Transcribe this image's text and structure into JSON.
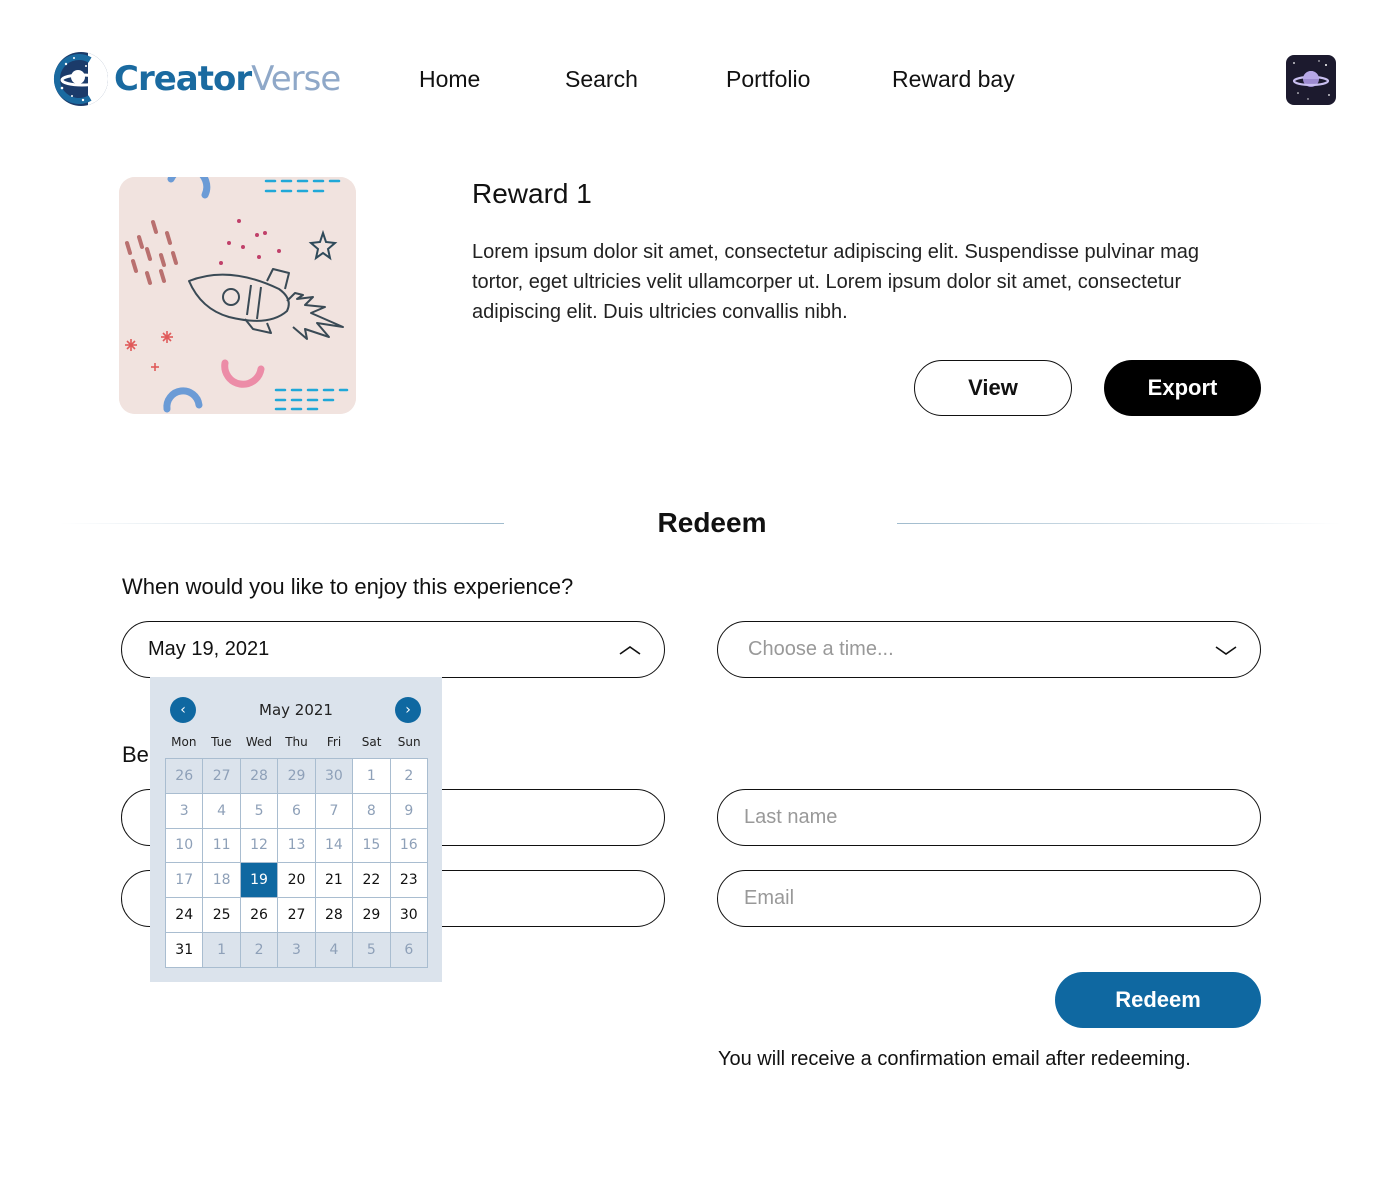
{
  "brand": {
    "name_part1": "Creator",
    "name_part2": "Verse"
  },
  "nav": {
    "items": [
      {
        "label": "Home"
      },
      {
        "label": "Search"
      },
      {
        "label": "Portfolio"
      },
      {
        "label": "Reward bay"
      }
    ]
  },
  "reward": {
    "title": "Reward 1",
    "description": "Lorem ipsum dolor sit amet, consectetur adipiscing elit. Suspendisse pulvinar mag\ntortor, eget ultricies velit ullamcorper ut. Lorem ipsum dolor sit amet, consectetur\nadipiscing elit. Duis ultricies convallis nibh.",
    "view_label": "View",
    "export_label": "Export"
  },
  "redeem": {
    "section_title": "Redeem",
    "question": "When would you like to enjoy this experience?",
    "date_value": "May 19, 2021",
    "time_placeholder": "Choose a time...",
    "partial_label": "Be",
    "last_name_placeholder": "Last name",
    "email_placeholder": "Email",
    "submit_label": "Redeem",
    "confirmation_note": "You will receive a confirmation email after redeeming."
  },
  "calendar": {
    "month_label": "May 2021",
    "prev_icon": "‹",
    "next_icon": "›",
    "weekdays": [
      "Mon",
      "Tue",
      "Wed",
      "Thu",
      "Fri",
      "Sat",
      "Sun"
    ],
    "weeks": [
      [
        {
          "d": "26",
          "s": "other"
        },
        {
          "d": "27",
          "s": "other"
        },
        {
          "d": "28",
          "s": "other"
        },
        {
          "d": "29",
          "s": "other"
        },
        {
          "d": "30",
          "s": "other"
        },
        {
          "d": "1",
          "s": "past"
        },
        {
          "d": "2",
          "s": "past"
        }
      ],
      [
        {
          "d": "3",
          "s": "past"
        },
        {
          "d": "4",
          "s": "past"
        },
        {
          "d": "5",
          "s": "past"
        },
        {
          "d": "6",
          "s": "past"
        },
        {
          "d": "7",
          "s": "past"
        },
        {
          "d": "8",
          "s": "past"
        },
        {
          "d": "9",
          "s": "past"
        }
      ],
      [
        {
          "d": "10",
          "s": "past"
        },
        {
          "d": "11",
          "s": "past"
        },
        {
          "d": "12",
          "s": "past"
        },
        {
          "d": "13",
          "s": "past"
        },
        {
          "d": "14",
          "s": "past"
        },
        {
          "d": "15",
          "s": "past"
        },
        {
          "d": "16",
          "s": "past"
        }
      ],
      [
        {
          "d": "17",
          "s": "past"
        },
        {
          "d": "18",
          "s": "past"
        },
        {
          "d": "19",
          "s": "selected"
        },
        {
          "d": "20",
          "s": "avail"
        },
        {
          "d": "21",
          "s": "avail"
        },
        {
          "d": "22",
          "s": "avail"
        },
        {
          "d": "23",
          "s": "avail"
        }
      ],
      [
        {
          "d": "24",
          "s": "avail"
        },
        {
          "d": "25",
          "s": "avail"
        },
        {
          "d": "26",
          "s": "avail"
        },
        {
          "d": "27",
          "s": "avail"
        },
        {
          "d": "28",
          "s": "avail"
        },
        {
          "d": "29",
          "s": "avail"
        },
        {
          "d": "30",
          "s": "avail"
        }
      ],
      [
        {
          "d": "31",
          "s": "avail"
        },
        {
          "d": "1",
          "s": "other"
        },
        {
          "d": "2",
          "s": "other"
        },
        {
          "d": "3",
          "s": "other"
        },
        {
          "d": "4",
          "s": "other"
        },
        {
          "d": "5",
          "s": "other"
        },
        {
          "d": "6",
          "s": "other"
        }
      ]
    ]
  },
  "colors": {
    "accent": "#0f68a1",
    "calendar_bg": "#dbe3ec",
    "brand_light": "#8fa8c8"
  }
}
